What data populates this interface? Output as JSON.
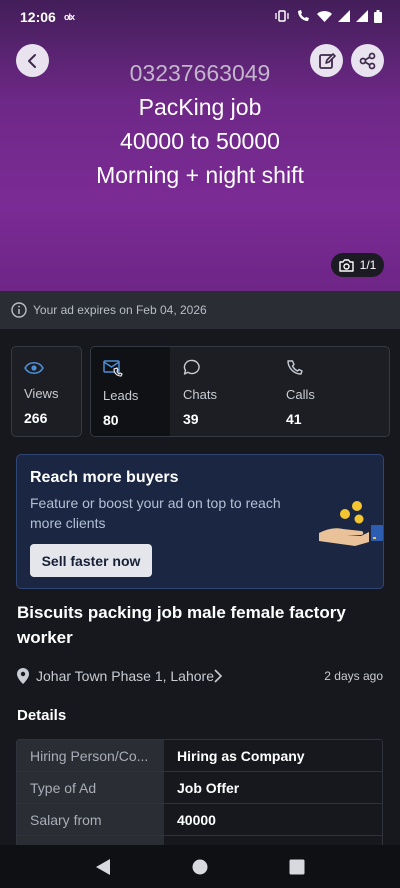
{
  "status_bar": {
    "time": "12:06",
    "notif": "olx"
  },
  "hero": {
    "lines": [
      "03237663049",
      "PacKing job",
      "40000 to 50000",
      "Morning + night shift"
    ],
    "photo_counter": "1/1"
  },
  "expiry": {
    "text": "Your ad expires on Feb 04, 2026"
  },
  "stats": {
    "views": {
      "label": "Views",
      "value": "266"
    },
    "leads": {
      "label": "Leads",
      "value": "80"
    },
    "chats": {
      "label": "Chats",
      "value": "39"
    },
    "calls": {
      "label": "Calls",
      "value": "41"
    }
  },
  "promo": {
    "title": "Reach more buyers",
    "subtitle": "Feature or boost your ad on top to reach more clients",
    "button": "Sell faster now"
  },
  "listing": {
    "title": "Biscuits packing job male female factory worker",
    "location": "Johar Town Phase 1, Lahore",
    "posted": "2 days ago"
  },
  "details": {
    "heading": "Details",
    "rows": [
      {
        "key": "Hiring Person/Co...",
        "value": "Hiring as Company"
      },
      {
        "key": "Type of Ad",
        "value": "Job Offer"
      },
      {
        "key": "Salary from",
        "value": "40000"
      },
      {
        "key": "",
        "value": ""
      }
    ]
  },
  "colors": {
    "hero_purple": "#7b2b95",
    "promo_bg": "#1b2742",
    "accent_blue": "#3a8bd8"
  },
  "icons": {
    "back": "arrow-left-icon",
    "edit": "edit-icon",
    "share": "share-icon",
    "camera": "camera-icon",
    "info": "info-icon",
    "views": "eye-icon",
    "leads": "envelope-phone-icon",
    "chats": "chat-bubble-icon",
    "calls": "phone-icon",
    "location": "location-pin-icon"
  }
}
